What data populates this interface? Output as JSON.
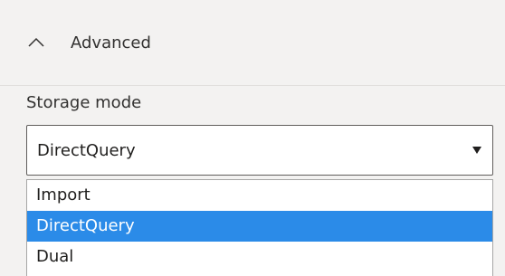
{
  "section": {
    "title": "Advanced",
    "icon": "chevron-up-icon",
    "expanded": true
  },
  "storage_mode": {
    "label": "Storage mode",
    "selected_value": "DirectQuery",
    "caret_icon": "caret-down-icon",
    "options": [
      "Import",
      "DirectQuery",
      "Dual"
    ],
    "highlighted_option": "DirectQuery"
  },
  "colors": {
    "highlight": "#2b8be8",
    "header_background": "#f3f2f1",
    "text": "#323130"
  }
}
